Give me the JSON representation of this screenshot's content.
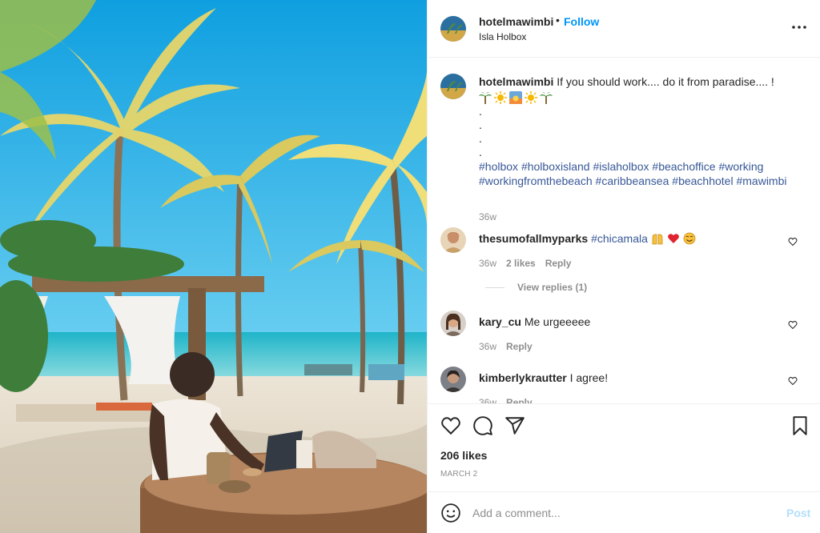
{
  "header": {
    "username": "hotelmawimbi",
    "separator": "•",
    "follow_label": "Follow",
    "location": "Isla Holbox",
    "more_icon": "more-horizontal-icon"
  },
  "caption": {
    "username": "hotelmawimbi",
    "text": "If you should work.... do it from paradise.... !",
    "emojis": [
      "palm-tree",
      "sun",
      "sunset",
      "sun",
      "palm-tree"
    ],
    "dots": [
      ".",
      ".",
      ".",
      "."
    ],
    "hashtags": [
      "#holbox",
      "#holboxisland",
      "#islaholbox",
      "#beachoffice",
      "#working",
      "#workingfromthebeach",
      "#caribbeansea",
      "#beachhotel",
      "#mawimbi"
    ],
    "time": "36w"
  },
  "comments": [
    {
      "username": "thesumofallmyparks",
      "tag": "#chicamala",
      "emojis": [
        "raised-hands",
        "red-heart",
        "smiling-face"
      ],
      "time": "36w",
      "likes": "2 likes",
      "reply": "Reply"
    },
    {
      "username": "kary_cu",
      "text": "Me urgeeeee",
      "time": "36w",
      "reply": "Reply"
    },
    {
      "username": "kimberlykrautter",
      "text": "I agree!",
      "time": "36w",
      "reply": "Reply"
    }
  ],
  "view_replies": "View replies (1)",
  "actions": {
    "likes": "206 likes",
    "date": "MARCH 2"
  },
  "add_comment": {
    "placeholder": "Add a comment...",
    "post_label": "Post"
  },
  "colors": {
    "link": "#0095f6",
    "hashtag": "#385898",
    "muted": "#8e8e8e",
    "post_disabled": "#b2dffc"
  }
}
